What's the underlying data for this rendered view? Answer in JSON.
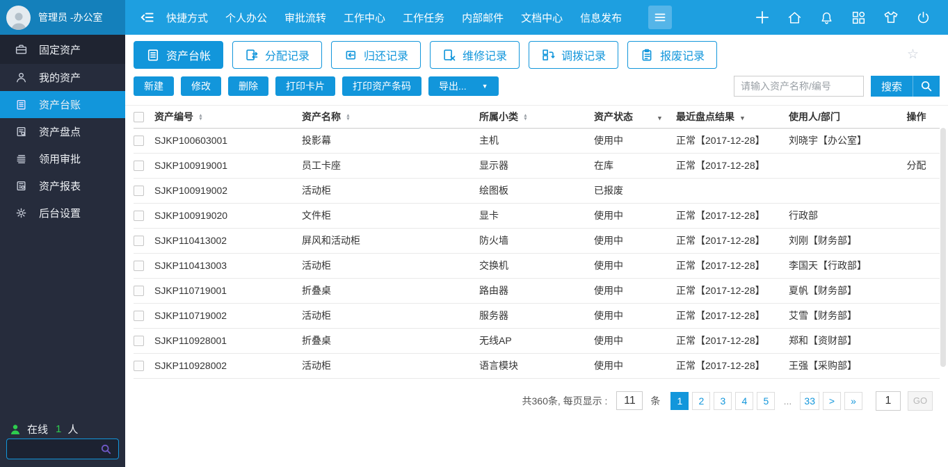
{
  "topbar": {
    "user_name": "管理员 -办公室",
    "menu": [
      "快捷方式",
      "个人办公",
      "审批流转",
      "工作中心",
      "工作任务",
      "内部邮件",
      "文档中心",
      "信息发布"
    ]
  },
  "sidebar": {
    "items": [
      {
        "key": "fixed-assets",
        "label": "固定资产",
        "icon": "briefcase-icon",
        "header": true
      },
      {
        "key": "my-assets",
        "label": "我的资产",
        "icon": "user-icon"
      },
      {
        "key": "asset-ledger",
        "label": "资产台账",
        "icon": "ledger-icon",
        "active": true
      },
      {
        "key": "asset-inventory",
        "label": "资产盘点",
        "icon": "inventory-icon"
      },
      {
        "key": "requisition-approval",
        "label": "领用审批",
        "icon": "approval-icon"
      },
      {
        "key": "asset-reports",
        "label": "资产报表",
        "icon": "report-icon"
      },
      {
        "key": "admin-settings",
        "label": "后台设置",
        "icon": "gear-icon"
      }
    ],
    "online_prefix": "在线",
    "online_count": "1",
    "online_suffix": "人"
  },
  "tabs": [
    {
      "key": "asset-ledger",
      "label": "资产台帐",
      "icon": "ledger-icon",
      "active": true
    },
    {
      "key": "assign-records",
      "label": "分配记录",
      "icon": "assign-icon"
    },
    {
      "key": "return-records",
      "label": "归还记录",
      "icon": "return-icon"
    },
    {
      "key": "repair-records",
      "label": "维修记录",
      "icon": "repair-icon"
    },
    {
      "key": "transfer-records",
      "label": "调拨记录",
      "icon": "transfer-icon"
    },
    {
      "key": "scrap-records",
      "label": "报废记录",
      "icon": "scrap-icon"
    }
  ],
  "toolbar": {
    "buttons": [
      {
        "key": "create",
        "label": "新建"
      },
      {
        "key": "modify",
        "label": "修改"
      },
      {
        "key": "delete",
        "label": "删除"
      },
      {
        "key": "print-card",
        "label": "打印卡片"
      },
      {
        "key": "print-barcode",
        "label": "打印资产条码"
      }
    ],
    "export_label": "导出...",
    "search_placeholder": "请输入资产名称/编号",
    "search_label": "搜索"
  },
  "table": {
    "columns": [
      {
        "label": "资产编号",
        "sort": "updown"
      },
      {
        "label": "资产名称",
        "sort": "updown"
      },
      {
        "label": "所属小类",
        "sort": "updown"
      },
      {
        "label": "资产状态",
        "sort": "caret-far"
      },
      {
        "label": "最近盘点结果",
        "sort": "caret"
      },
      {
        "label": "使用人/部门",
        "sort": "none"
      },
      {
        "label": "操作",
        "sort": "none"
      }
    ],
    "rows": [
      {
        "code": "SJKP100603001",
        "name": "投影幕",
        "category": "主机",
        "status": "使用中",
        "check": "正常【2017-12-28】",
        "user": "刘晓宇【办公室】",
        "action": ""
      },
      {
        "code": "SJKP100919001",
        "name": "员工卡座",
        "category": "显示器",
        "status": "在库",
        "check": "正常【2017-12-28】",
        "user": "",
        "action": "分配"
      },
      {
        "code": "SJKP100919002",
        "name": "活动柜",
        "category": "绘图板",
        "status": "已报废",
        "check": "",
        "user": "",
        "action": ""
      },
      {
        "code": "SJKP100919020",
        "name": "文件柜",
        "category": "显卡",
        "status": "使用中",
        "check": "正常【2017-12-28】",
        "user": "行政部",
        "action": ""
      },
      {
        "code": "SJKP110413002",
        "name": "屏风和活动柜",
        "category": "防火墙",
        "status": "使用中",
        "check": "正常【2017-12-28】",
        "user": "刘刚【财务部】",
        "action": ""
      },
      {
        "code": "SJKP110413003",
        "name": "活动柜",
        "category": "交换机",
        "status": "使用中",
        "check": "正常【2017-12-28】",
        "user": "李国天【行政部】",
        "action": ""
      },
      {
        "code": "SJKP110719001",
        "name": "折叠桌",
        "category": "路由器",
        "status": "使用中",
        "check": "正常【2017-12-28】",
        "user": "夏帆【财务部】",
        "action": ""
      },
      {
        "code": "SJKP110719002",
        "name": "活动柜",
        "category": "服务器",
        "status": "使用中",
        "check": "正常【2017-12-28】",
        "user": "艾雪【财务部】",
        "action": ""
      },
      {
        "code": "SJKP110928001",
        "name": "折叠桌",
        "category": "无线AP",
        "status": "使用中",
        "check": "正常【2017-12-28】",
        "user": "郑和【资财部】",
        "action": ""
      },
      {
        "code": "SJKP110928002",
        "name": "活动柜",
        "category": "语言模块",
        "status": "使用中",
        "check": "正常【2017-12-28】",
        "user": "王强【采购部】",
        "action": ""
      }
    ]
  },
  "pagination": {
    "total_label": "共360条, 每页显示 :",
    "per_page": "11",
    "unit": "条",
    "pages": [
      "1",
      "2",
      "3",
      "4",
      "5",
      "...",
      "33",
      ">",
      "»"
    ],
    "active_page": "1",
    "goto_value": "1",
    "go_label": "GO"
  },
  "colors": {
    "accent": "#1296db",
    "navbar": "#1e9fe0",
    "user_area": "#1480bb",
    "sidebar": "#262c3c",
    "online_green": "#2ecc4e"
  }
}
